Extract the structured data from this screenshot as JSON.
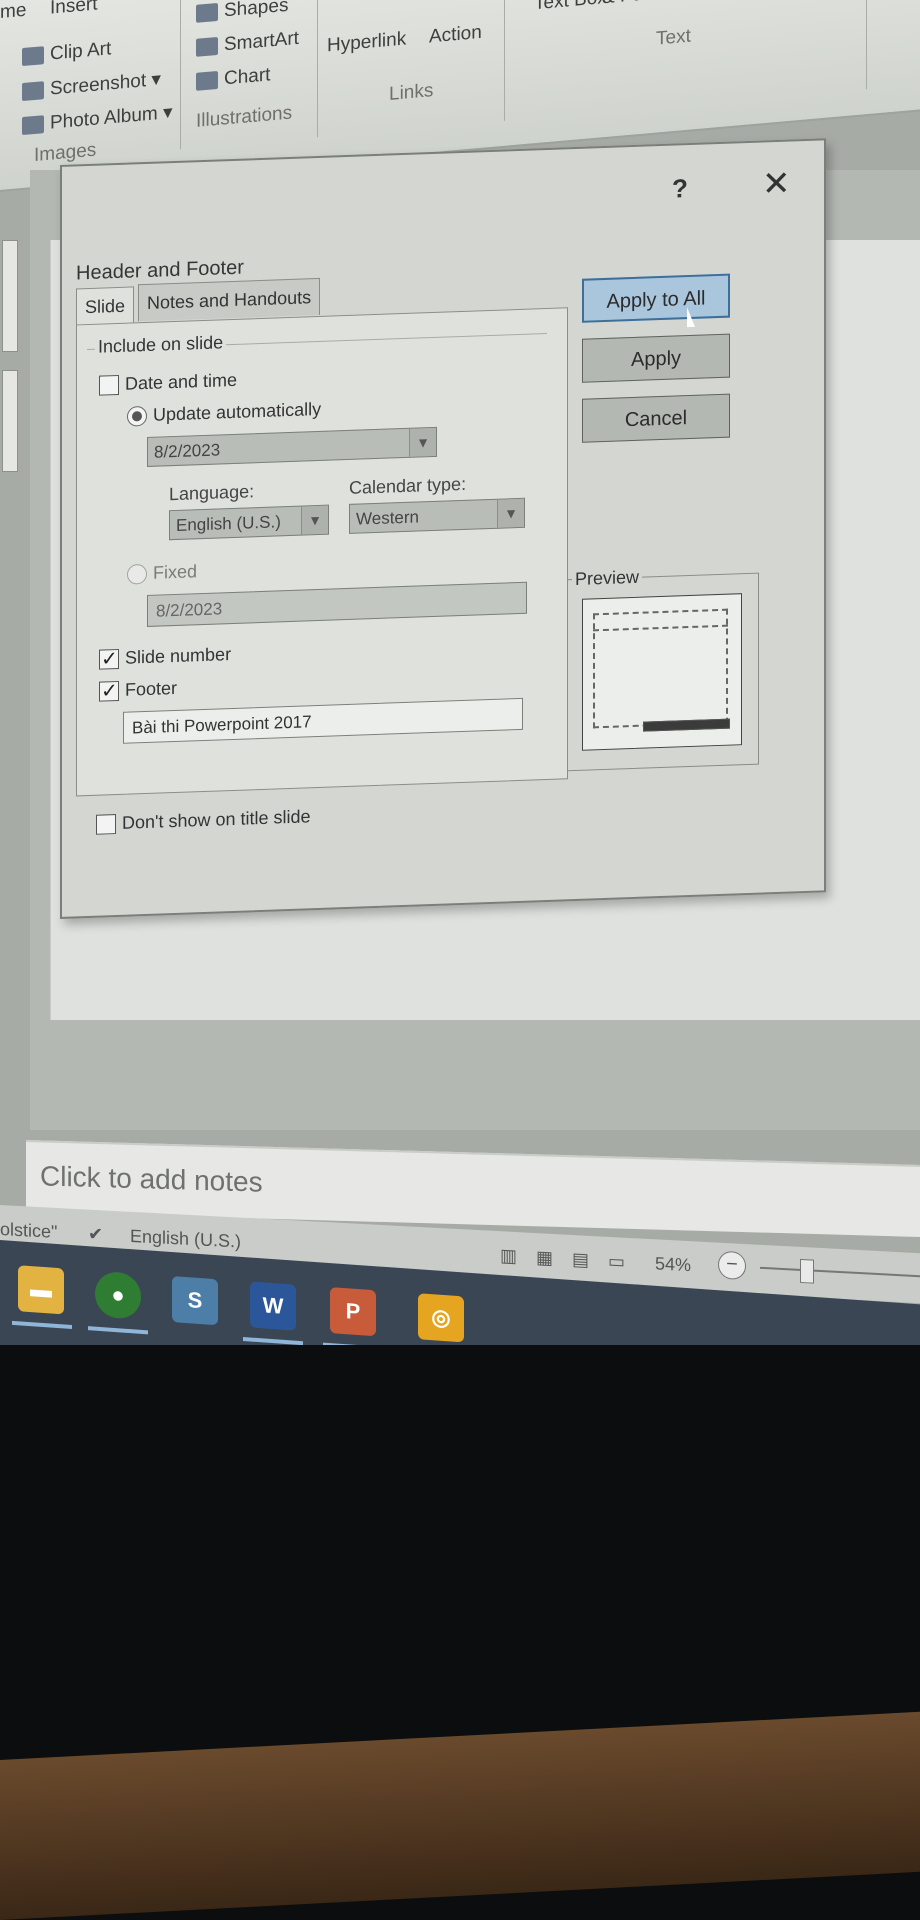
{
  "ribbon": {
    "tab_fragments": [
      "me",
      "Insert"
    ],
    "images_group": {
      "items": [
        "Clip Art",
        "Screenshot ▾",
        "Photo Album ▾"
      ],
      "caption": "Images"
    },
    "illustrations_group": {
      "items": [
        "Shapes",
        "SmartArt",
        "Chart"
      ],
      "caption": "Illustrations"
    },
    "links_group": {
      "items": [
        "Hyperlink",
        "Action"
      ],
      "caption": "Links"
    },
    "text_group": {
      "items": [
        "Text Box",
        "& Footer"
      ],
      "caption": "Text"
    }
  },
  "dialog": {
    "title": "Header and Footer",
    "help": "?",
    "close": "✕",
    "tabs": [
      "Slide",
      "Notes and Handouts"
    ],
    "active_tab": "Slide",
    "include_label": "Include on slide",
    "date_time": {
      "label": "Date and time",
      "checked": false
    },
    "update_auto": {
      "label": "Update automatically",
      "selected": true,
      "value": "8/2/2023"
    },
    "language": {
      "label": "Language:",
      "value": "English (U.S.)"
    },
    "calendar": {
      "label": "Calendar type:",
      "value": "Western"
    },
    "fixed": {
      "label": "Fixed",
      "selected": false,
      "value": "8/2/2023"
    },
    "slide_number": {
      "label": "Slide number",
      "checked": true
    },
    "footer": {
      "label": "Footer",
      "checked": true,
      "value": "Bài thi Powerpoint 2017"
    },
    "dont_show_title": {
      "label": "Don't show on title slide",
      "checked": false
    },
    "buttons": {
      "apply_all": "Apply to All",
      "apply": "Apply",
      "cancel": "Cancel"
    },
    "preview_label": "Preview"
  },
  "notes_placeholder": "Click to add notes",
  "status": {
    "left_fragment": "olstice\"",
    "language": "English (U.S.)",
    "zoom": "54%"
  },
  "taskbar": {
    "apps": [
      "file-explorer",
      "chrome",
      "stylus-app",
      "word",
      "powerpoint",
      "pdf-app"
    ]
  }
}
